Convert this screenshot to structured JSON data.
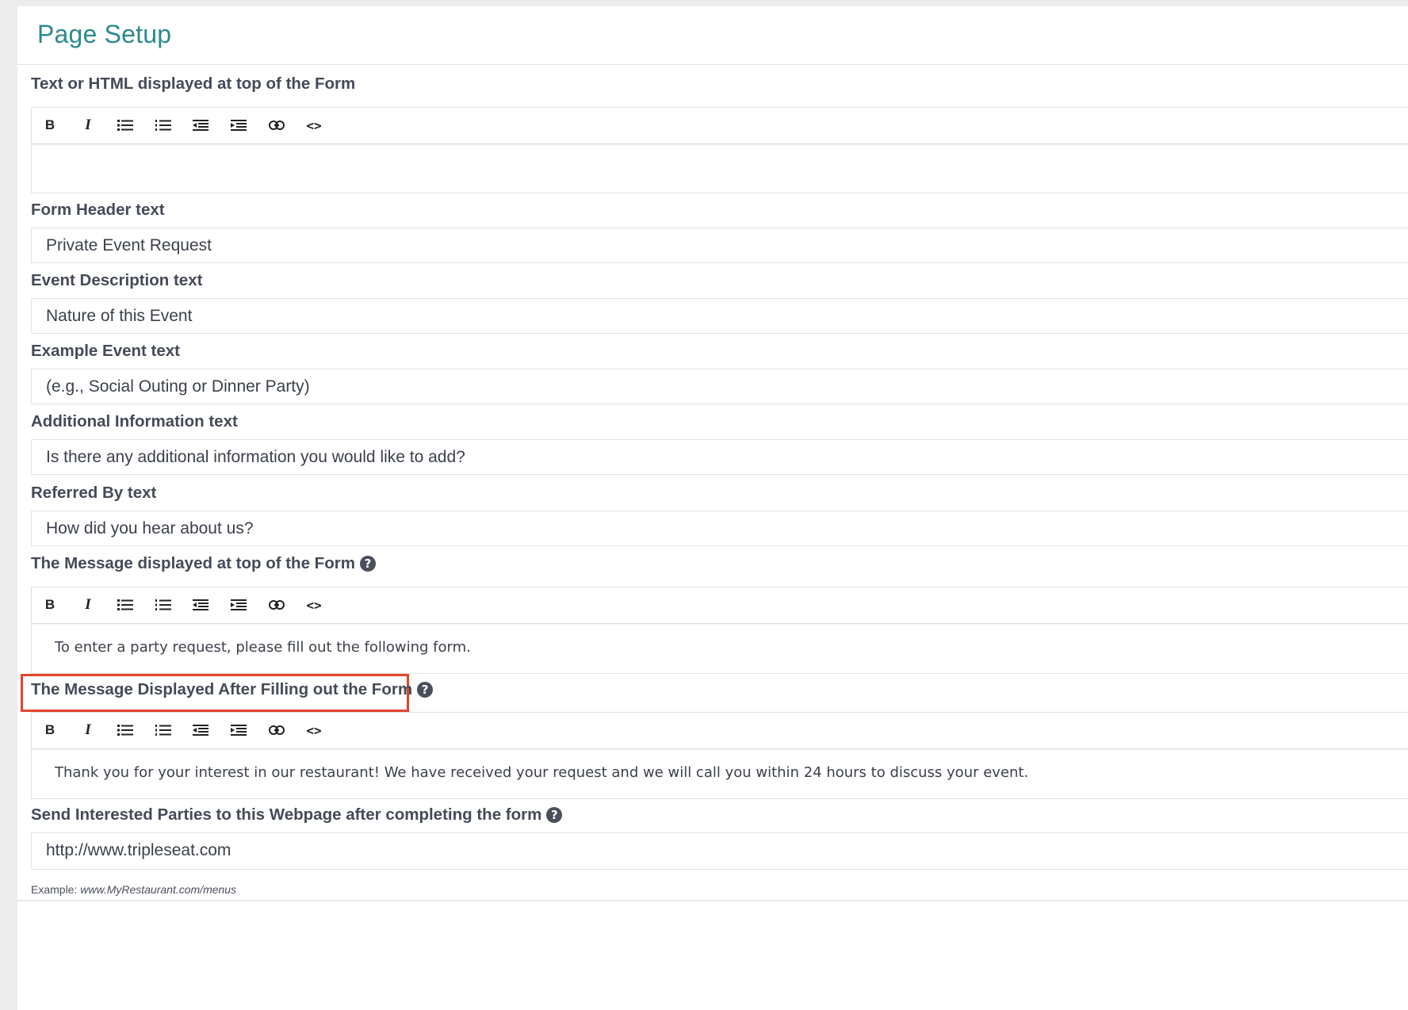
{
  "page": {
    "title": "Page Setup"
  },
  "toolbar_buttons": {
    "bold": "B",
    "italic": "I",
    "bullet_list": "unordered-list-icon",
    "numbered_list": "ordered-list-icon",
    "outdent": "outdent-icon",
    "indent": "indent-icon",
    "link": "link-icon",
    "code": "<>"
  },
  "fields": {
    "top_html": {
      "label": "Text or HTML displayed at top of the Form",
      "value": ""
    },
    "form_header": {
      "label": "Form Header text",
      "value": "Private Event Request"
    },
    "event_description": {
      "label": "Event Description text",
      "value": "Nature of this Event"
    },
    "example_event": {
      "label": "Example Event text",
      "value": "(e.g., Social Outing or Dinner Party)"
    },
    "additional_info": {
      "label": "Additional Information text",
      "value": "Is there any additional information you would like to add?"
    },
    "referred_by": {
      "label": "Referred By text",
      "value": "How did you hear about us?"
    },
    "message_top": {
      "label": "The Message displayed at top of the Form",
      "value": "To enter a party request, please fill out the following form."
    },
    "message_after": {
      "label": "The Message Displayed After Filling out the Form",
      "value": "Thank you for your interest in our restaurant! We have received your request and we will call you within 24 hours to discuss your event."
    },
    "redirect_url": {
      "label": "Send Interested Parties to this Webpage after completing the form",
      "value": "http://www.tripleseat.com",
      "hint_prefix": "Example:",
      "hint_example": "www.MyRestaurant.com/menus"
    }
  },
  "colors": {
    "title": "#2b8a8c",
    "highlight": "#e0452e",
    "label": "#444a57",
    "border": "#e3e3e3"
  }
}
